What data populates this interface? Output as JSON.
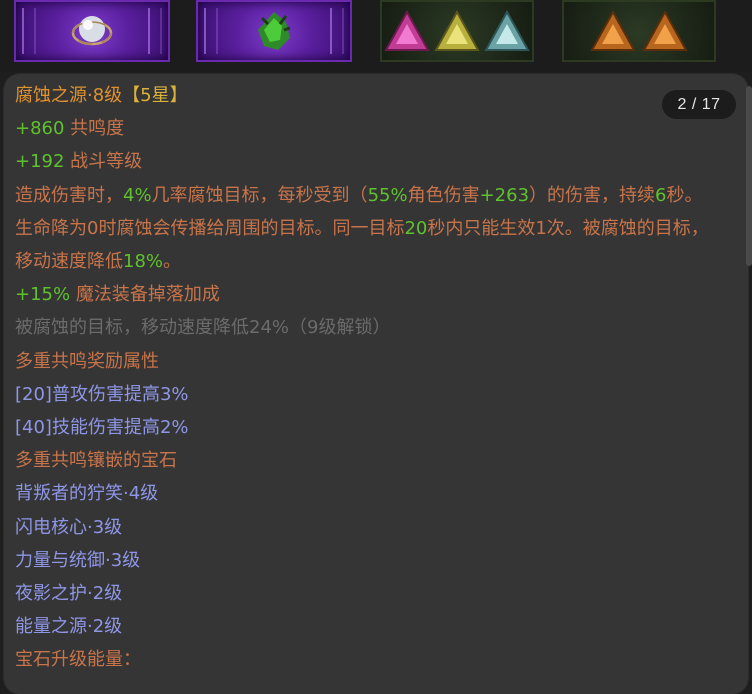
{
  "pagination": {
    "label": "2 / 17"
  },
  "slots": [
    {
      "icon": "orb-gem-icon"
    },
    {
      "icon": "green-claw-gem-icon"
    },
    {
      "icons": [
        "pink-triangle-gem-icon",
        "yellow-triangle-gem-icon",
        "teal-triangle-gem-icon"
      ]
    },
    {
      "icons": [
        "orange-triangle-gem-icon",
        "orange-triangle-gem-icon"
      ]
    }
  ],
  "tooltip": {
    "title": {
      "name": "腐蚀之源·8级",
      "stars": "【5星】"
    },
    "stats": [
      {
        "value": "+860",
        "label": " 共鸣度"
      },
      {
        "value": "+192",
        "label": " 战斗等级"
      }
    ],
    "description": {
      "t1": "造成伤害时，",
      "v1": "4%",
      "t2": "几率腐蚀目标，每秒受到（",
      "v2": "55%",
      "t3": "角色伤害",
      "v3": "+263",
      "t4": "）的伤害，持续",
      "v4": "6",
      "t5": "秒。生命降为0时腐蚀会传播给周围的目标。同一目标",
      "v5": "20",
      "t6": "秒内只能生效1次。被腐蚀的目标，移动速度降低",
      "v6": "18%",
      "t7": "。"
    },
    "bonus": {
      "value": "+15%",
      "label": " 魔法装备掉落加成"
    },
    "locked": "被腐蚀的目标，移动速度降低24%（9级解锁）",
    "multi_bonus_header": "多重共鸣奖励属性",
    "multi_bonus": [
      "[20]普攻伤害提高3%",
      "[40]技能伤害提高2%"
    ],
    "socketed_header": "多重共鸣镶嵌的宝石",
    "socketed": [
      "背叛者的狞笑·4级",
      "闪电核心·3级",
      "力量与统御·3级",
      "夜影之护·2级",
      "能量之源·2级"
    ],
    "energy_label": "宝石升级能量："
  }
}
